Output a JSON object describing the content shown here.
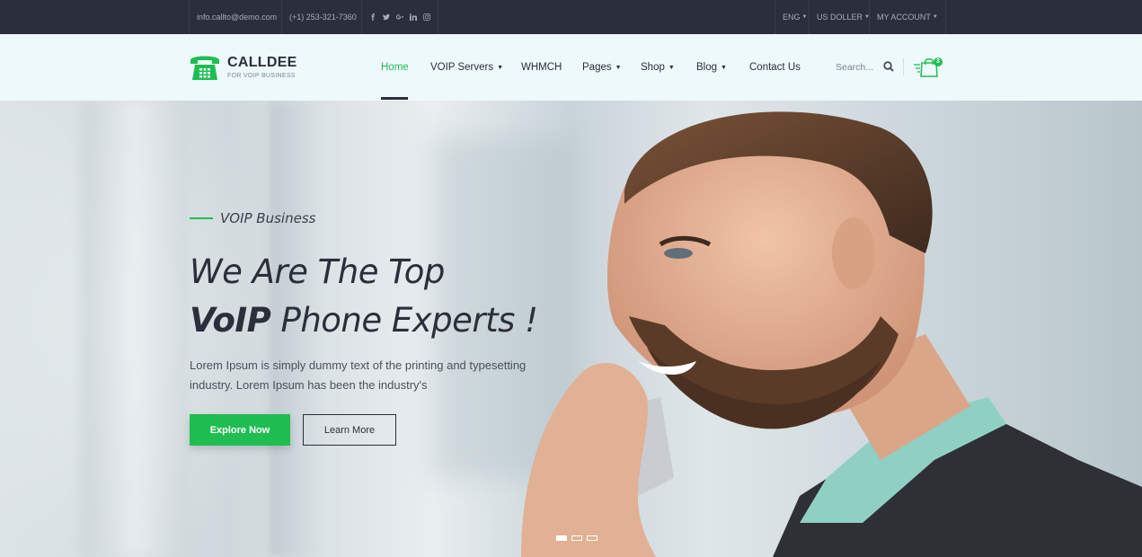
{
  "topbar": {
    "email": "info.callto@demo.com",
    "phone": "(+1) 253-321-7360",
    "social_icons": [
      "facebook-icon",
      "twitter-icon",
      "google-plus-icon",
      "linkedin-icon",
      "instagram-icon"
    ],
    "language": "ENG",
    "currency": "US DOLLER",
    "account": "MY ACCOUNT"
  },
  "brand": {
    "name": "CALLDEE",
    "tagline": "FOR VOIP BUSINESS",
    "accent": "#1fbd52",
    "dark": "#2b2e3b"
  },
  "nav": {
    "items": [
      {
        "label": "Home",
        "active": true
      },
      {
        "label": "VOIP Servers",
        "dropdown": true
      },
      {
        "label": "WHMCH"
      },
      {
        "label": "Pages",
        "dropdown": true
      },
      {
        "label": "Shop",
        "dropdown": true
      },
      {
        "label": "Blog",
        "dropdown": true
      },
      {
        "label": "Contact Us"
      }
    ],
    "search_placeholder": "Search...",
    "cart_count": "3"
  },
  "hero": {
    "kicker": "VOIP Business",
    "headline_line1": "We Are The Top",
    "headline_bold": "VoIP",
    "headline_rest": " Phone Experts !",
    "lede": "Lorem Ipsum is simply dummy text of the printing and typesetting industry. Lorem Ipsum has been the industry's",
    "primary_button": "Explore Now",
    "secondary_button": "Learn More",
    "slides_total": 3,
    "slide_active": 1
  }
}
